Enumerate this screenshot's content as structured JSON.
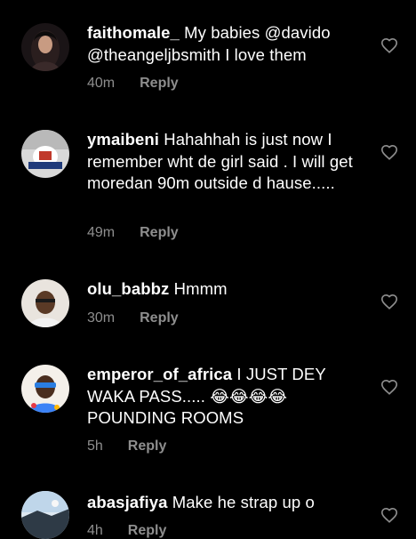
{
  "colors": {
    "background": "#000000",
    "text": "#ffffff",
    "meta": "#8e8e8e"
  },
  "comments": [
    {
      "username": "faithomale_",
      "text": "My babies @davido @theangeljbsmith I love them",
      "time": "40m",
      "reply": "Reply",
      "icon": "heart-outline-icon"
    },
    {
      "username": "ymaibeni",
      "text": "Hahahhah is just now I remember wht de girl said . I will get moredan 90m outside d hause.....",
      "time": "49m",
      "reply": "Reply",
      "icon": "heart-outline-icon"
    },
    {
      "username": "olu_babbz",
      "text": "Hmmm",
      "time": "30m",
      "reply": "Reply",
      "icon": "heart-outline-icon"
    },
    {
      "username": "emperor_of_africa",
      "text": "I JUST DEY WAKA PASS..... 😂😂😂😂 POUNDING ROOMS",
      "time": "5h",
      "reply": "Reply",
      "icon": "heart-outline-icon"
    },
    {
      "username": "abasjafiya",
      "text": "Make he strap up o",
      "time": "4h",
      "reply": "Reply",
      "icon": "heart-outline-icon"
    }
  ]
}
